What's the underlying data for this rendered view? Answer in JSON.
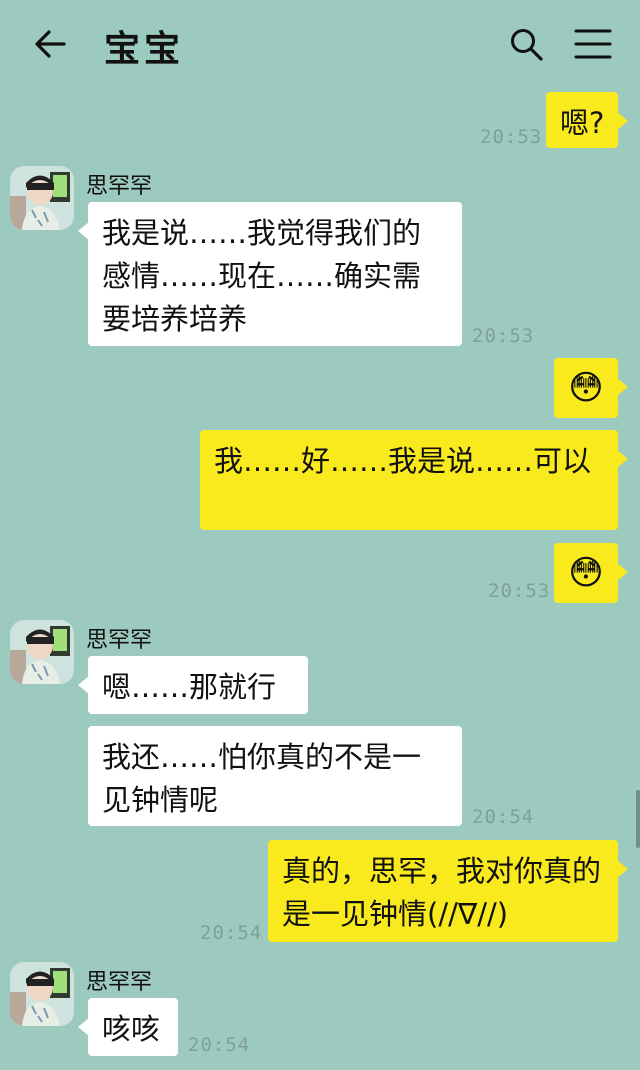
{
  "header": {
    "title": "宝宝",
    "back_icon": "arrow-left-icon",
    "search_icon": "search-icon",
    "menu_icon": "hamburger-menu-icon"
  },
  "contact": {
    "name": "思罕罕"
  },
  "messages": [
    {
      "dir": "out",
      "text": "嗯?",
      "time": "20:53"
    },
    {
      "dir": "in",
      "nick": "思罕罕",
      "text": "我是说……我觉得我们的感情……现在……确实需要培养培养",
      "time": "20:53"
    },
    {
      "dir": "out",
      "emoji": "flushed-face",
      "text": "😳"
    },
    {
      "dir": "out",
      "text": "我……好……我是说……可以"
    },
    {
      "dir": "out",
      "emoji": "flushed-face",
      "text": "😳",
      "time": "20:53"
    },
    {
      "dir": "in",
      "nick": "思罕罕",
      "text": "嗯……那就行"
    },
    {
      "dir": "in",
      "text": "我还……怕你真的不是一见钟情呢",
      "time": "20:54"
    },
    {
      "dir": "out",
      "text": "真的，思罕，我对你真的是一见钟情(//∇//)",
      "time": "20:54"
    },
    {
      "dir": "in",
      "nick": "思罕罕",
      "text": "咳咳",
      "time": "20:54"
    }
  ],
  "colors": {
    "background": "#9dcabf",
    "incoming_bubble": "#ffffff",
    "outgoing_bubble": "#f9ea1e",
    "timestamp": "#7f9f98"
  }
}
